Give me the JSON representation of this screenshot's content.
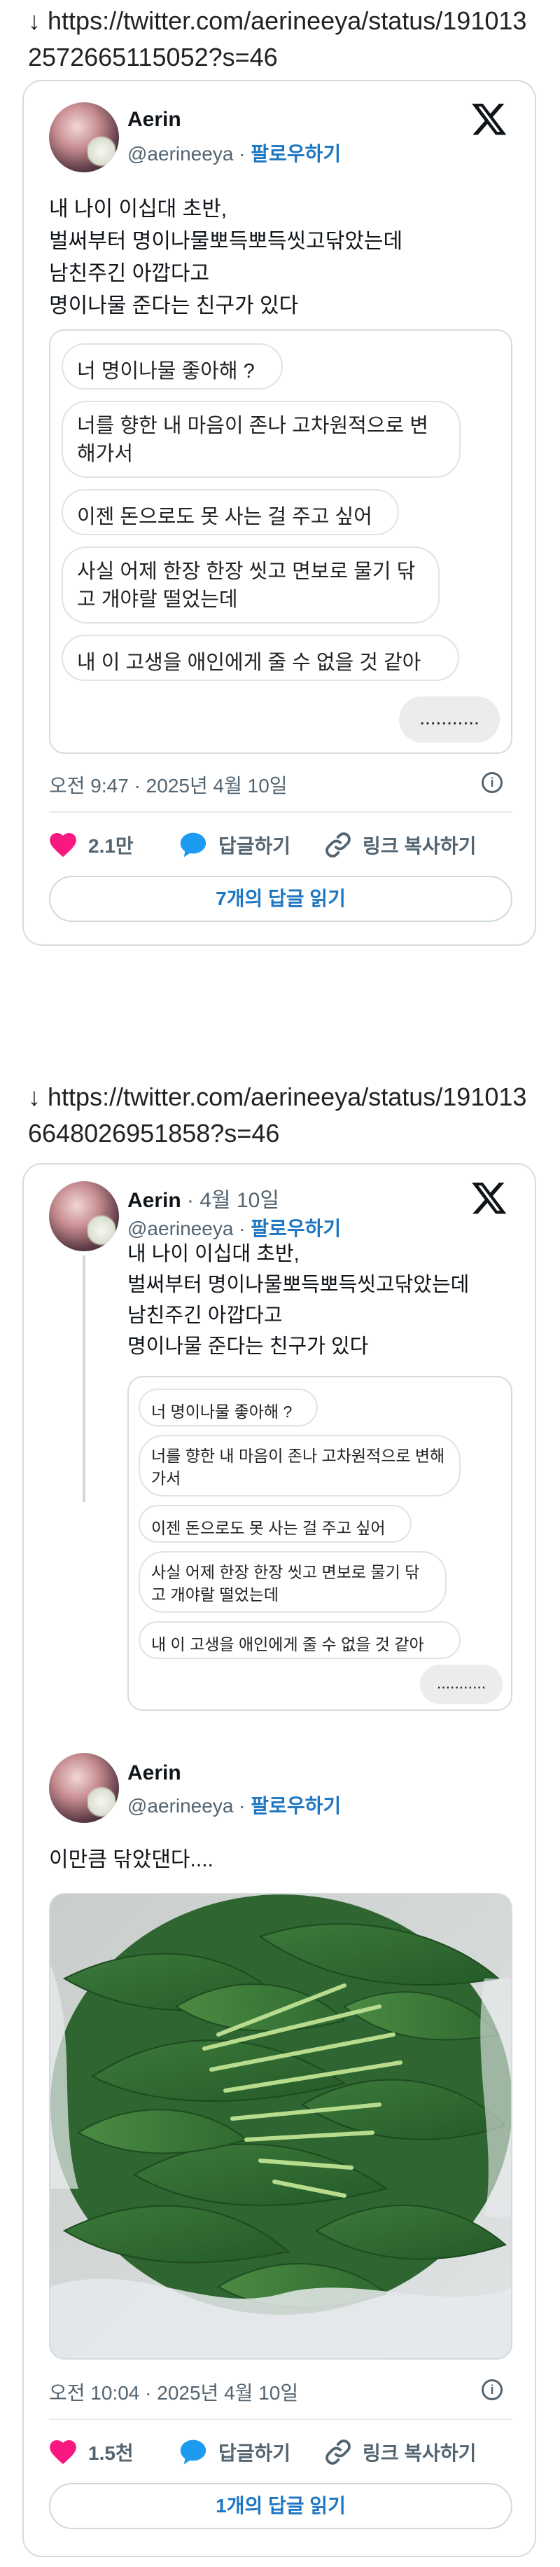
{
  "post1": {
    "arrow": "↓",
    "url": "https://twitter.com/aerineeya/status/1910132572665115052?s=46",
    "author_name": "Aerin",
    "handle": "@aerineeya",
    "separator": " · ",
    "follow_label": "팔로우하기",
    "text_lines": [
      "내 나이 이십대 초반,",
      "벌써부터 명이나물뽀득뽀득씻고닦았는데",
      "남친주긴 아깝다고",
      "명이나물 준다는 친구가 있다"
    ],
    "chat_bubbles": [
      "너 명이나물 좋아해 ?",
      "너를 향한 내 마음이 존나 고차원적으로 변해가서",
      "이젠 돈으로도 못 사는 걸 주고 싶어",
      "사실 어제 한장 한장 씻고 면보로 물기 닦고 개야랄 떨었는데",
      "내 이 고생을 애인에게 줄 수 없을 것 같아"
    ],
    "chat_reply": "...........",
    "timestamp": "오전 9:47 · 2025년 4월 10일",
    "like_count": "2.1만",
    "reply_label": "답글하기",
    "copy_link_label": "링크 복사하기",
    "read_replies_label": "7개의 답글 읽기"
  },
  "post2": {
    "arrow": "↓",
    "url": "https://twitter.com/aerineeya/status/1910136648026951858?s=46",
    "quoted": {
      "author_name": "Aerin",
      "date": " · 4월 10일",
      "handle": "@aerineeya",
      "separator": " · ",
      "follow_label": "팔로우하기",
      "text_lines": [
        "내 나이 이십대 초반,",
        "벌써부터 명이나물뽀득뽀득씻고닦았는데",
        "남친주긴 아깝다고",
        "명이나물 준다는 친구가 있다"
      ],
      "chat_bubbles": [
        "너 명이나물 좋아해 ?",
        "너를 향한 내 마음이 존나 고차원적으로 변해가서",
        "이젠 돈으로도 못 사는 걸 주고 싶어",
        "사실 어제 한장 한장 씻고 면보로 물기 닦고 개야랄 떨었는데",
        "내 이 고생을 애인에게 줄 수 없을 것 같아"
      ],
      "chat_reply": "..........."
    },
    "author_name": "Aerin",
    "handle": "@aerineeya",
    "separator": " · ",
    "follow_label": "팔로우하기",
    "text": "이만큼 닦았댄다....",
    "timestamp": "오전 10:04 · 2025년 4월 10일",
    "like_count": "1.5천",
    "reply_label": "답글하기",
    "copy_link_label": "링크 복사하기",
    "read_replies_label": "1개의 답글 읽기"
  },
  "colors": {
    "like": "#f91880",
    "reply_icon": "#1d9bf0",
    "follow": "#1d76c2",
    "border": "#d5dbe0",
    "muted": "#536471"
  },
  "icons": [
    "heart-icon",
    "chat-bubble-icon",
    "link-icon",
    "info-icon",
    "x-logo-icon"
  ]
}
